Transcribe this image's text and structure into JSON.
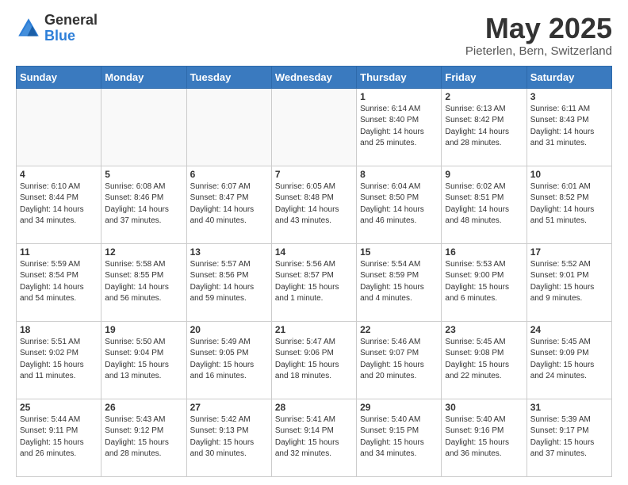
{
  "header": {
    "logo_general": "General",
    "logo_blue": "Blue",
    "title": "May 2025",
    "subtitle": "Pieterlen, Bern, Switzerland"
  },
  "calendar": {
    "days_of_week": [
      "Sunday",
      "Monday",
      "Tuesday",
      "Wednesday",
      "Thursday",
      "Friday",
      "Saturday"
    ],
    "weeks": [
      [
        {
          "day": "",
          "info": ""
        },
        {
          "day": "",
          "info": ""
        },
        {
          "day": "",
          "info": ""
        },
        {
          "day": "",
          "info": ""
        },
        {
          "day": "1",
          "info": "Sunrise: 6:14 AM\nSunset: 8:40 PM\nDaylight: 14 hours\nand 25 minutes."
        },
        {
          "day": "2",
          "info": "Sunrise: 6:13 AM\nSunset: 8:42 PM\nDaylight: 14 hours\nand 28 minutes."
        },
        {
          "day": "3",
          "info": "Sunrise: 6:11 AM\nSunset: 8:43 PM\nDaylight: 14 hours\nand 31 minutes."
        }
      ],
      [
        {
          "day": "4",
          "info": "Sunrise: 6:10 AM\nSunset: 8:44 PM\nDaylight: 14 hours\nand 34 minutes."
        },
        {
          "day": "5",
          "info": "Sunrise: 6:08 AM\nSunset: 8:46 PM\nDaylight: 14 hours\nand 37 minutes."
        },
        {
          "day": "6",
          "info": "Sunrise: 6:07 AM\nSunset: 8:47 PM\nDaylight: 14 hours\nand 40 minutes."
        },
        {
          "day": "7",
          "info": "Sunrise: 6:05 AM\nSunset: 8:48 PM\nDaylight: 14 hours\nand 43 minutes."
        },
        {
          "day": "8",
          "info": "Sunrise: 6:04 AM\nSunset: 8:50 PM\nDaylight: 14 hours\nand 46 minutes."
        },
        {
          "day": "9",
          "info": "Sunrise: 6:02 AM\nSunset: 8:51 PM\nDaylight: 14 hours\nand 48 minutes."
        },
        {
          "day": "10",
          "info": "Sunrise: 6:01 AM\nSunset: 8:52 PM\nDaylight: 14 hours\nand 51 minutes."
        }
      ],
      [
        {
          "day": "11",
          "info": "Sunrise: 5:59 AM\nSunset: 8:54 PM\nDaylight: 14 hours\nand 54 minutes."
        },
        {
          "day": "12",
          "info": "Sunrise: 5:58 AM\nSunset: 8:55 PM\nDaylight: 14 hours\nand 56 minutes."
        },
        {
          "day": "13",
          "info": "Sunrise: 5:57 AM\nSunset: 8:56 PM\nDaylight: 14 hours\nand 59 minutes."
        },
        {
          "day": "14",
          "info": "Sunrise: 5:56 AM\nSunset: 8:57 PM\nDaylight: 15 hours\nand 1 minute."
        },
        {
          "day": "15",
          "info": "Sunrise: 5:54 AM\nSunset: 8:59 PM\nDaylight: 15 hours\nand 4 minutes."
        },
        {
          "day": "16",
          "info": "Sunrise: 5:53 AM\nSunset: 9:00 PM\nDaylight: 15 hours\nand 6 minutes."
        },
        {
          "day": "17",
          "info": "Sunrise: 5:52 AM\nSunset: 9:01 PM\nDaylight: 15 hours\nand 9 minutes."
        }
      ],
      [
        {
          "day": "18",
          "info": "Sunrise: 5:51 AM\nSunset: 9:02 PM\nDaylight: 15 hours\nand 11 minutes."
        },
        {
          "day": "19",
          "info": "Sunrise: 5:50 AM\nSunset: 9:04 PM\nDaylight: 15 hours\nand 13 minutes."
        },
        {
          "day": "20",
          "info": "Sunrise: 5:49 AM\nSunset: 9:05 PM\nDaylight: 15 hours\nand 16 minutes."
        },
        {
          "day": "21",
          "info": "Sunrise: 5:47 AM\nSunset: 9:06 PM\nDaylight: 15 hours\nand 18 minutes."
        },
        {
          "day": "22",
          "info": "Sunrise: 5:46 AM\nSunset: 9:07 PM\nDaylight: 15 hours\nand 20 minutes."
        },
        {
          "day": "23",
          "info": "Sunrise: 5:45 AM\nSunset: 9:08 PM\nDaylight: 15 hours\nand 22 minutes."
        },
        {
          "day": "24",
          "info": "Sunrise: 5:45 AM\nSunset: 9:09 PM\nDaylight: 15 hours\nand 24 minutes."
        }
      ],
      [
        {
          "day": "25",
          "info": "Sunrise: 5:44 AM\nSunset: 9:11 PM\nDaylight: 15 hours\nand 26 minutes."
        },
        {
          "day": "26",
          "info": "Sunrise: 5:43 AM\nSunset: 9:12 PM\nDaylight: 15 hours\nand 28 minutes."
        },
        {
          "day": "27",
          "info": "Sunrise: 5:42 AM\nSunset: 9:13 PM\nDaylight: 15 hours\nand 30 minutes."
        },
        {
          "day": "28",
          "info": "Sunrise: 5:41 AM\nSunset: 9:14 PM\nDaylight: 15 hours\nand 32 minutes."
        },
        {
          "day": "29",
          "info": "Sunrise: 5:40 AM\nSunset: 9:15 PM\nDaylight: 15 hours\nand 34 minutes."
        },
        {
          "day": "30",
          "info": "Sunrise: 5:40 AM\nSunset: 9:16 PM\nDaylight: 15 hours\nand 36 minutes."
        },
        {
          "day": "31",
          "info": "Sunrise: 5:39 AM\nSunset: 9:17 PM\nDaylight: 15 hours\nand 37 minutes."
        }
      ]
    ]
  }
}
